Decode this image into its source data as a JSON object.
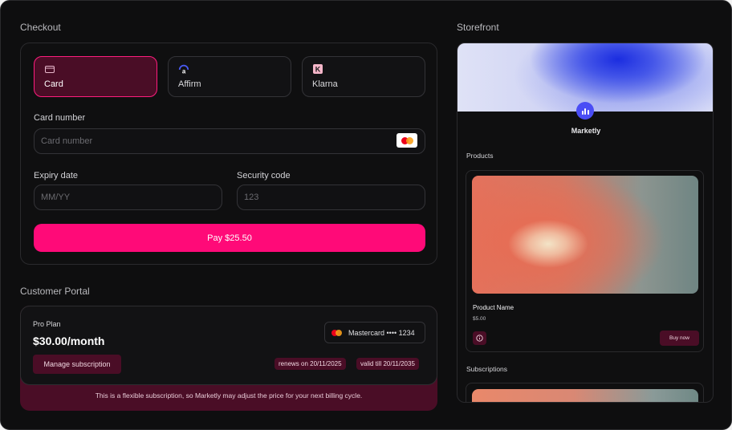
{
  "checkout": {
    "title": "Checkout",
    "payment_methods": [
      {
        "label": "Card",
        "icon": "card-icon",
        "active": true
      },
      {
        "label": "Affirm",
        "icon": "affirm-logo-icon",
        "active": false
      },
      {
        "label": "Klarna",
        "icon": "klarna-logo-icon",
        "active": false
      }
    ],
    "card_number": {
      "label": "Card number",
      "placeholder": "Card number",
      "brand_icon": "mastercard-icon"
    },
    "expiry": {
      "label": "Expiry date",
      "placeholder": "MM/YY"
    },
    "security": {
      "label": "Security code",
      "placeholder": "123"
    },
    "pay_button": "Pay $25.50"
  },
  "portal": {
    "title": "Customer Portal",
    "plan_name": "Pro Plan",
    "price": "$30.00/month",
    "manage_button": "Manage subscription",
    "payment_card": "Mastercard •••• 1234",
    "renews": "renews on 20/11/2025",
    "valid": "valid till 20/11/2035",
    "note": "This is a flexible subscription, so Marketly may adjust the price for your next billing cycle."
  },
  "storefront": {
    "title": "Storefront",
    "brand": "Marketly",
    "products_heading": "Products",
    "product": {
      "name": "Product Name",
      "price": "$5.00",
      "buy_button": "Buy now"
    },
    "subscriptions_heading": "Subscriptions"
  },
  "colors": {
    "accent": "#ff0a78",
    "accent_dark": "#4a0d26",
    "background": "#0e0e0f",
    "brand_logo": "#4a4df5"
  }
}
